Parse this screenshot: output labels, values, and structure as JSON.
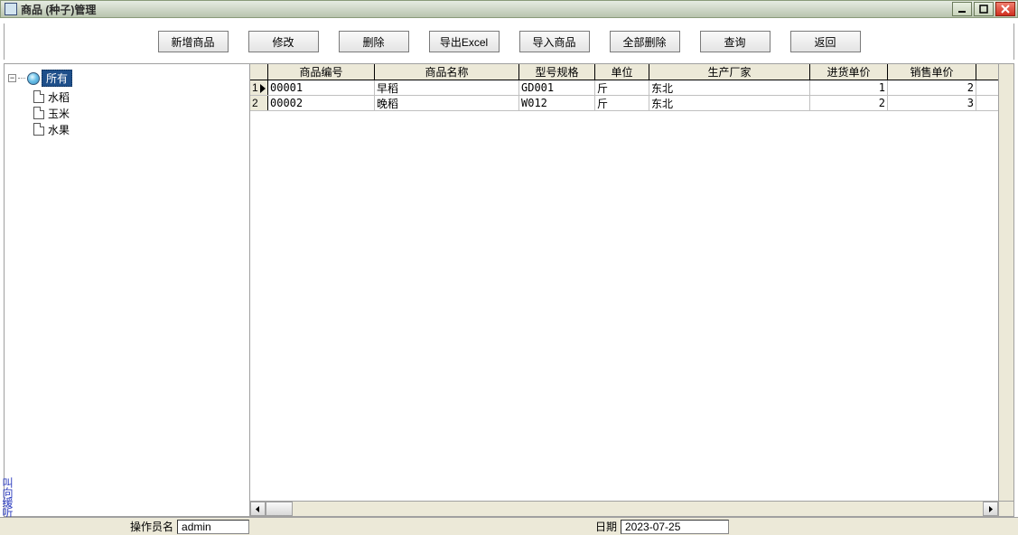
{
  "window": {
    "title": "商品 (种子)管理"
  },
  "toolbar": {
    "add": "新增商品",
    "edit": "修改",
    "delete": "删除",
    "export_excel": "导出Excel",
    "import": "导入商品",
    "delete_all": "全部删除",
    "query": "查询",
    "back": "返回"
  },
  "tree": {
    "root": "所有",
    "items": [
      "水稻",
      "玉米",
      "水果"
    ]
  },
  "grid": {
    "headers": {
      "code": "商品编号",
      "name": "商品名称",
      "model": "型号规格",
      "unit": "单位",
      "maker": "生产厂家",
      "in_price": "进货单价",
      "out_price": "销售单价"
    },
    "rows": [
      {
        "n": "1",
        "code": "00001",
        "name": "早稻",
        "model": "GD001",
        "unit": "斤",
        "maker": "东北",
        "in_price": "1",
        "out_price": "2"
      },
      {
        "n": "2",
        "code": "00002",
        "name": "晚稻",
        "model": "W012",
        "unit": "斤",
        "maker": "东北",
        "in_price": "2",
        "out_price": "3"
      }
    ]
  },
  "statusbar": {
    "operator_label": "操作员名",
    "operator_value": "admin",
    "date_label": "日期",
    "date_value": "2023-07-25"
  },
  "side_text": "叫向缓听"
}
